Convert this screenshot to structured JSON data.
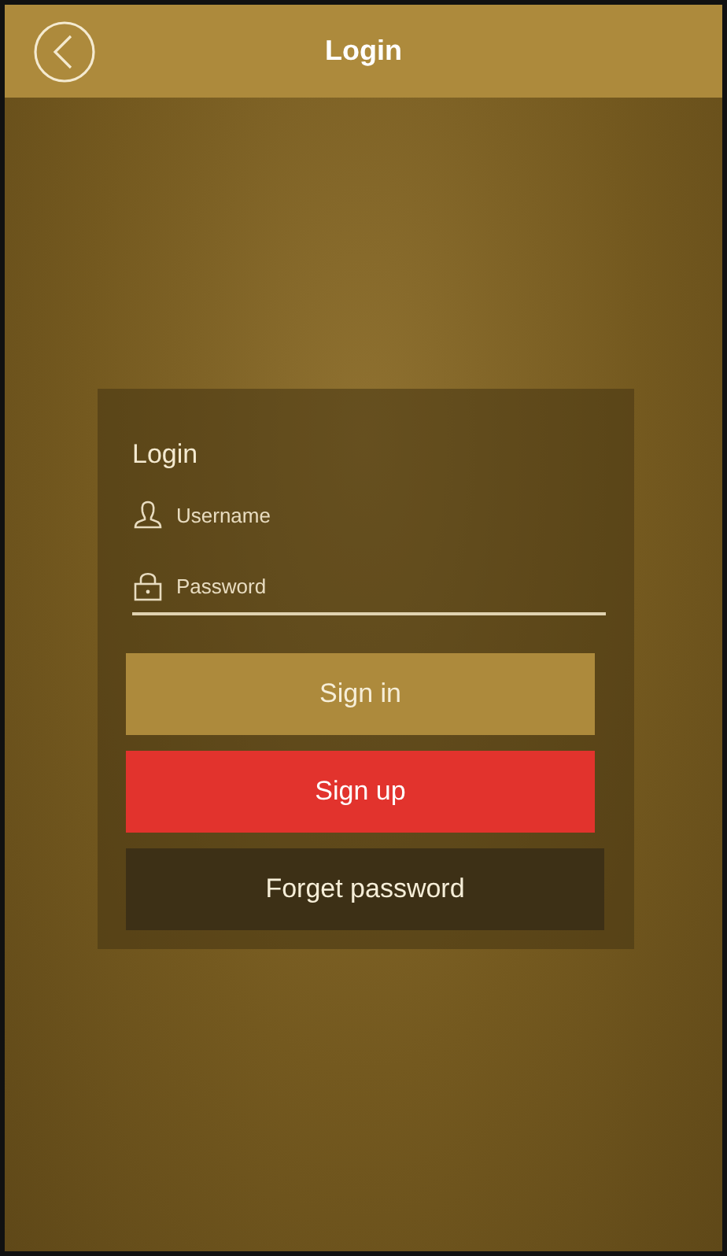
{
  "header": {
    "title": "Login"
  },
  "form": {
    "title": "Login",
    "fields": [
      {
        "kind": "username",
        "placeholder": "Username"
      },
      {
        "kind": "password",
        "placeholder": "Password"
      }
    ],
    "buttons": [
      {
        "kind": "primary",
        "label": "Sign in"
      },
      {
        "kind": "danger",
        "label": "Sign up"
      },
      {
        "kind": "dark",
        "label": "Forget password"
      }
    ]
  }
}
